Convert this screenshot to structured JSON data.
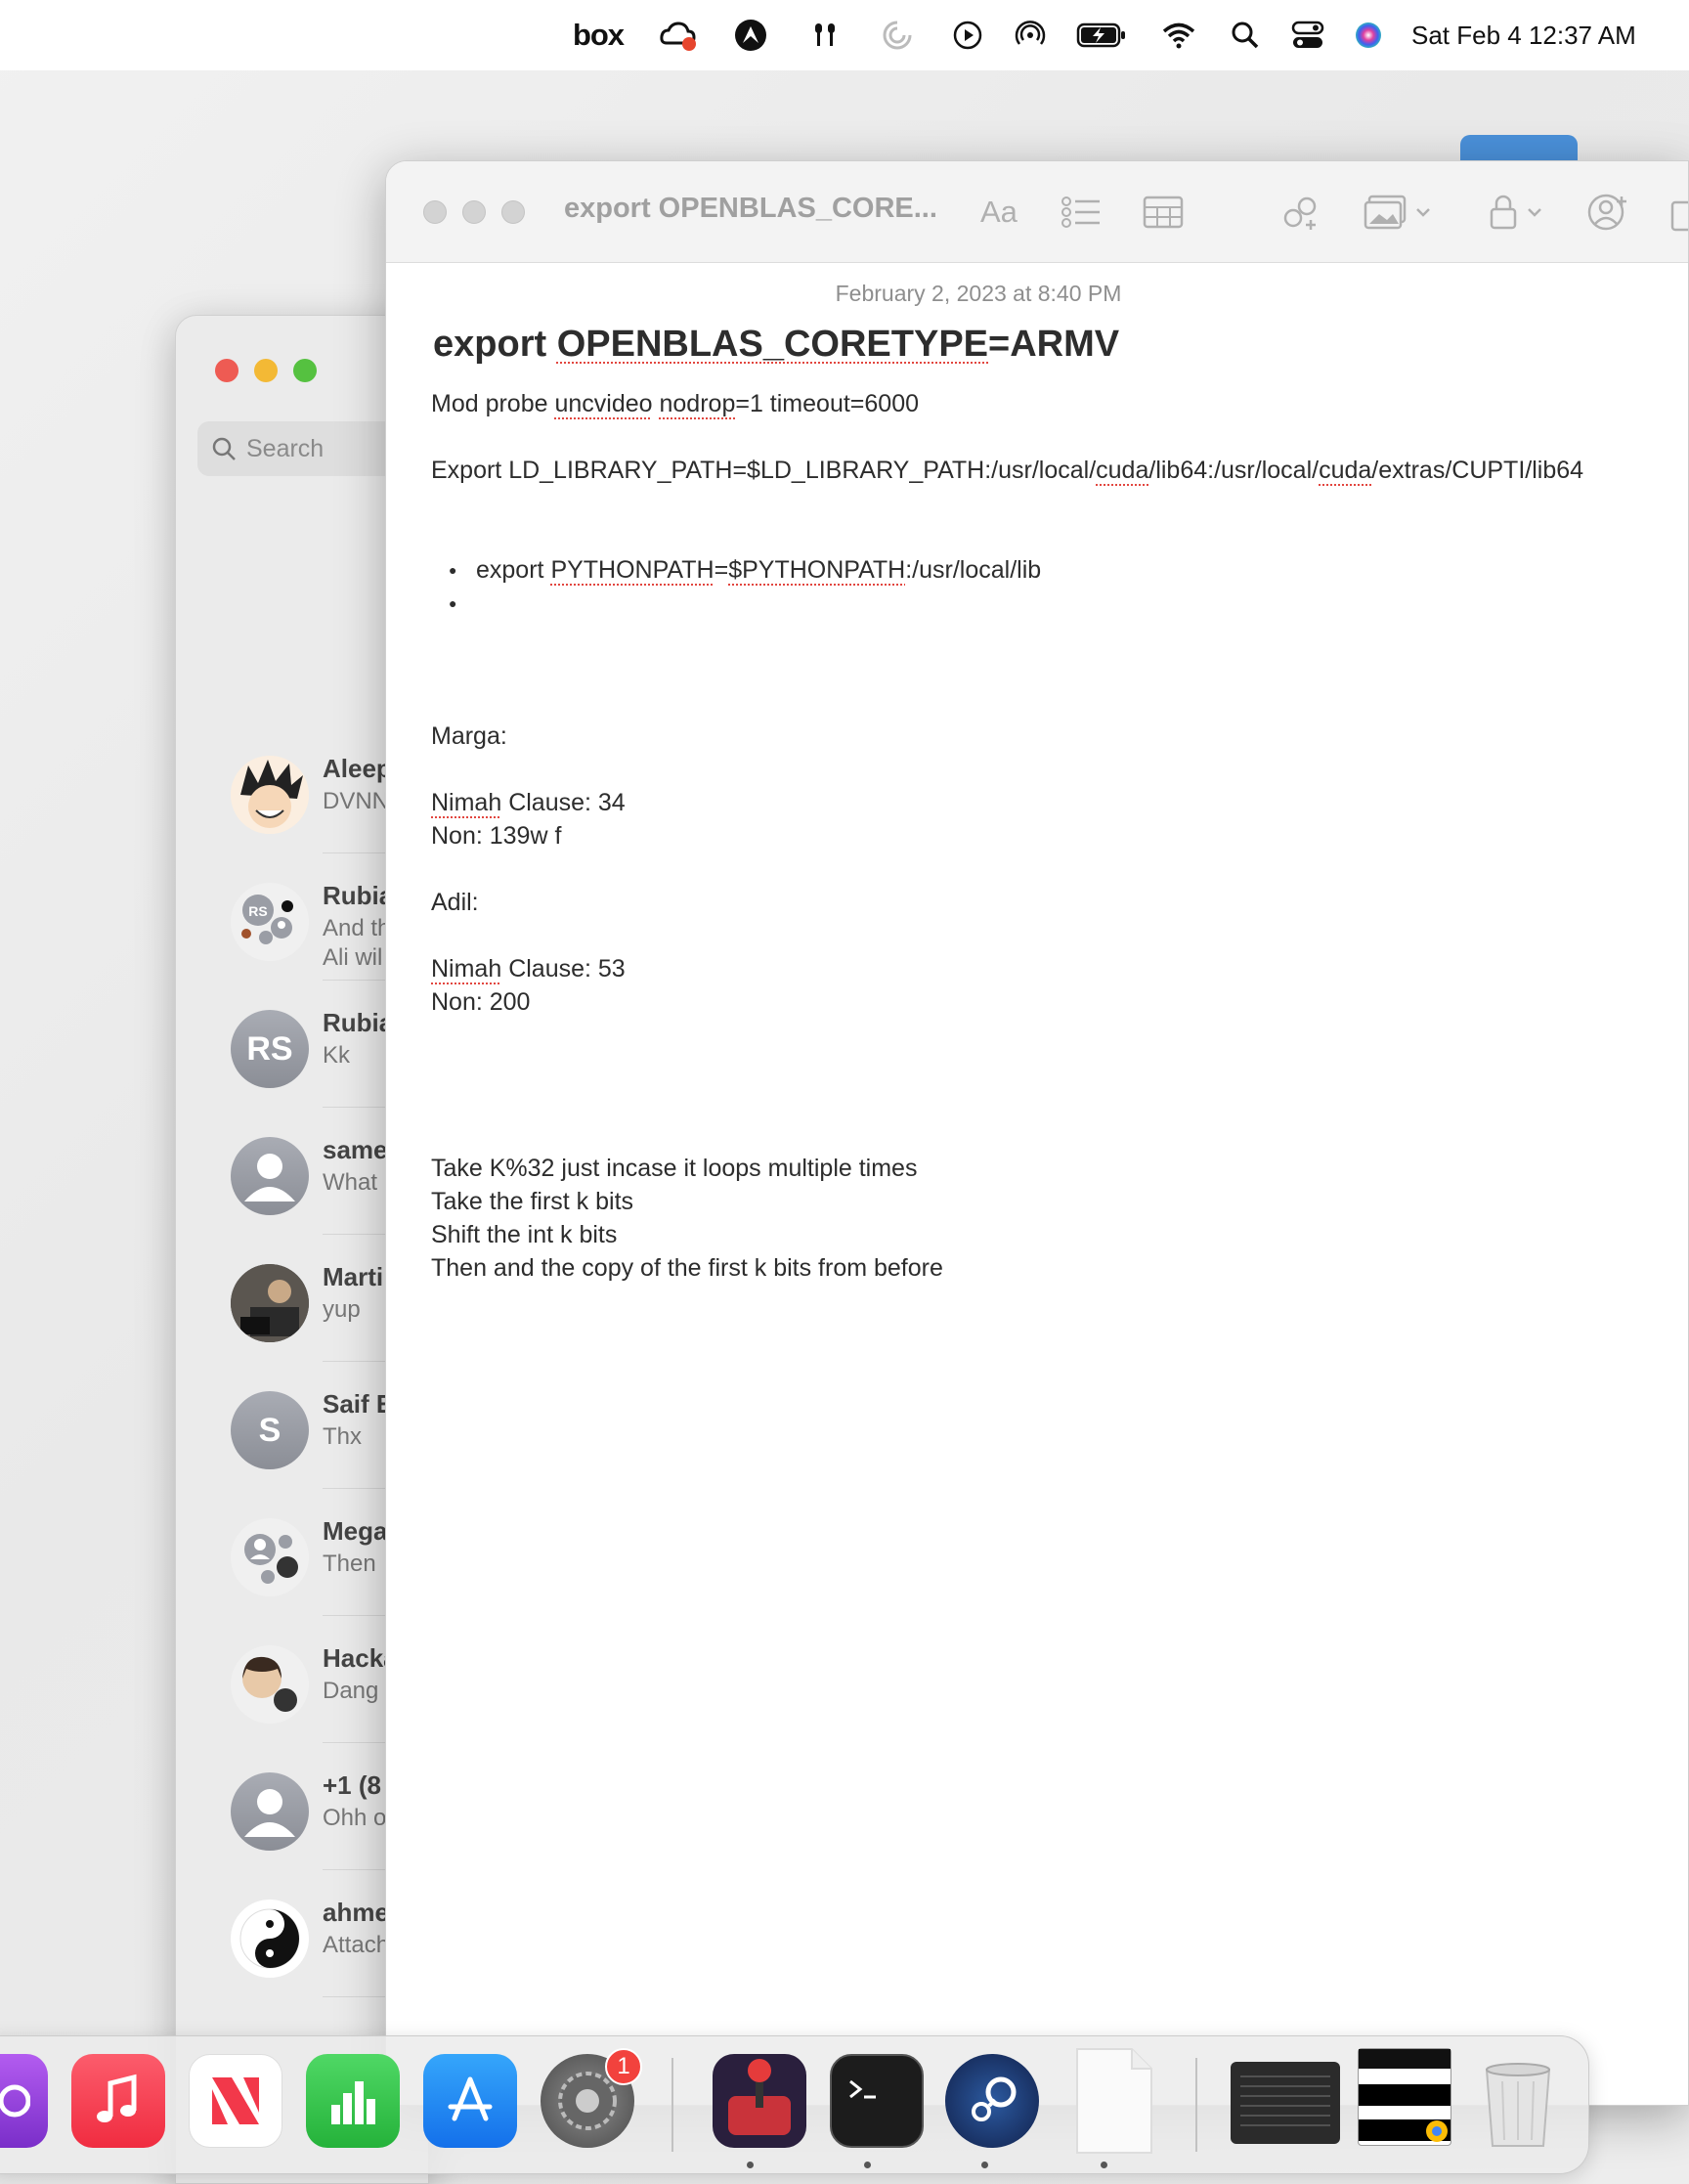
{
  "menubar": {
    "box_label": "box",
    "clock": "Sat Feb 4  12:37 AM",
    "status_icons": [
      "creative-cloud-icon",
      "wing-icon",
      "airpods-icon",
      "spinner-icon",
      "play-icon",
      "airdrop-icon",
      "battery-charging-icon",
      "wifi-icon",
      "search-icon",
      "control-center-icon",
      "siri-icon"
    ]
  },
  "messages": {
    "search_placeholder": "Search",
    "conversations": [
      {
        "name": "Aleep",
        "preview": "DVNN"
      },
      {
        "name": "Rubia",
        "preview": "And th\nAli wil"
      },
      {
        "name": "Rubia",
        "preview": "Kk",
        "initials": "RS"
      },
      {
        "name": "same",
        "preview": "What"
      },
      {
        "name": "Marti",
        "preview": "yup"
      },
      {
        "name": "Saif E",
        "preview": "Thx",
        "initials": "S"
      },
      {
        "name": "Mega",
        "preview": "Then"
      },
      {
        "name": "Hacka",
        "preview": "Dang"
      },
      {
        "name": "+1 (8",
        "preview": "Ohh o"
      },
      {
        "name": "ahme",
        "preview": "Attach"
      }
    ]
  },
  "notes": {
    "window_title": "export OPENBLAS_CORE...",
    "format_label": "Aa",
    "date": "February 2, 2023 at 8:40 PM",
    "heading_parts": [
      "export ",
      "OPENBLAS_CORETYPE",
      "=ARMV"
    ],
    "line1_parts": [
      "Mod probe ",
      "uncvideo",
      " ",
      "nodrop",
      "=1 timeout=6000"
    ],
    "line2_parts": [
      "Export LD_LIBRARY_PATH=$LD_LIBRARY_PATH:/usr/local/",
      "cuda",
      "/lib64:/usr/local/",
      "cuda",
      "/extras/CUPTI/lib64"
    ],
    "bullet1_parts": [
      "export ",
      "PYTHONPATH",
      "=",
      "$PYTHONPATH",
      ":/usr/local/lib"
    ],
    "bullet2": "",
    "marga_label": "Marga:",
    "marga_clause_parts": [
      "Nimah",
      " Clause: 34"
    ],
    "marga_non": "Non: 139w f",
    "adil_label": "Adil:",
    "adil_clause_parts": [
      "Nimah",
      " Clause: 53"
    ],
    "adil_non": "Non: 200",
    "algo_lines": [
      "Take K%32 just incase it loops multiple times",
      "Take the first k bits",
      "Shift the int k bits",
      "Then and the copy of the first k bits from before"
    ]
  },
  "dock": {
    "apps": [
      "podcasts-icon",
      "music-icon",
      "news-icon",
      "numbers-icon",
      "app-store-icon",
      "system-settings-icon",
      "joystick-app-icon",
      "terminal-icon",
      "steam-icon",
      "document-icon",
      "screenshot-thumbnail",
      "chrome-window-thumbnail",
      "trash-icon"
    ],
    "settings_badge": "1",
    "colors": {
      "music": "#fa3c4c",
      "numbers": "#33c74a",
      "app_store": "#1d8df4",
      "steam": "#1b3a6b"
    }
  }
}
